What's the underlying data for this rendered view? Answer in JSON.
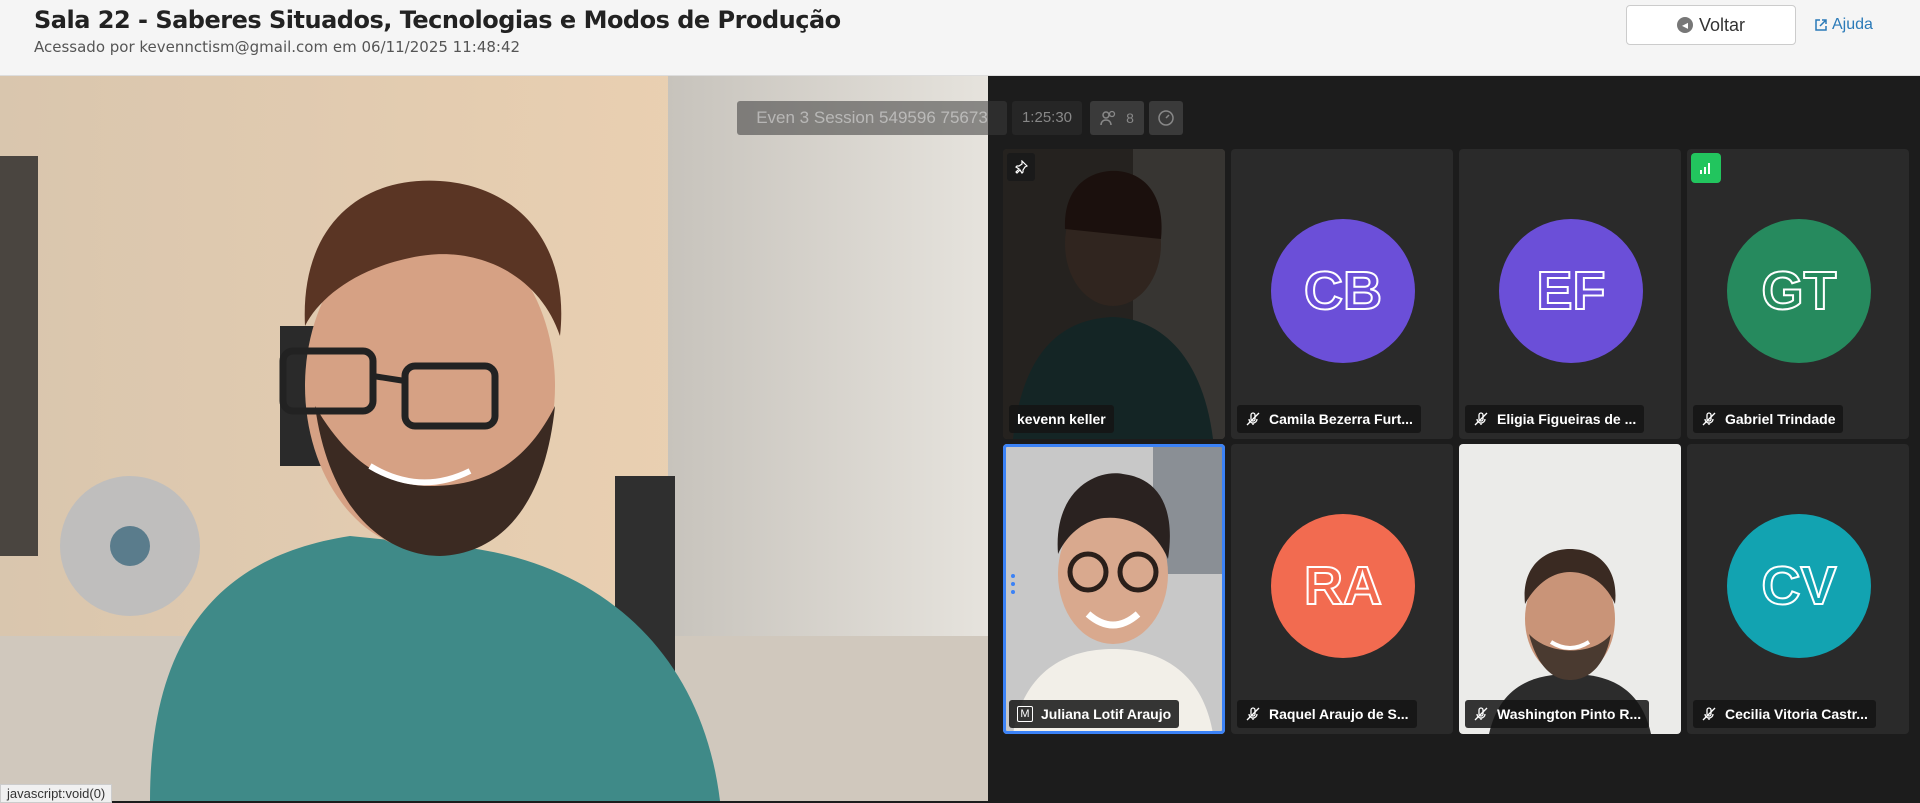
{
  "header": {
    "title": "Sala 22 - Saberes Situados, Tecnologias e Modos de Produção",
    "subtitle": "Acessado por kevennctism@gmail.com em 06/11/2025 11:48:42",
    "back_label": "Voltar",
    "help_label": "Ajuda"
  },
  "status_bar": {
    "text": "javascript:void(0)"
  },
  "toolbar": {
    "session_label": "Even 3 Session 549596 75673",
    "timer": "1:25:30",
    "participant_count": "8"
  },
  "participants": [
    {
      "name": "kevenn keller",
      "type": "video",
      "muted": false,
      "pinned": true
    },
    {
      "name": "Camila Bezerra Furt...",
      "initials": "CB",
      "color": "#6b4fd8",
      "muted": true
    },
    {
      "name": "Eligia Figueiras de ...",
      "initials": "EF",
      "color": "#6b4fd8",
      "muted": true
    },
    {
      "name": "Gabriel Trindade",
      "initials": "GT",
      "color": "#268a5e",
      "muted": true,
      "speaking": true
    },
    {
      "name": "Juliana Lotif Araujo",
      "type": "video",
      "muted": false,
      "moderator": true,
      "active": true
    },
    {
      "name": "Raquel Araujo de S...",
      "initials": "RA",
      "color": "#f26b50",
      "muted": true
    },
    {
      "name": "Washington Pinto R...",
      "type": "video",
      "muted": true
    },
    {
      "name": "Cecilia Vitoria Castr...",
      "initials": "CV",
      "color": "#12a3b1",
      "muted": true
    }
  ],
  "colors": {
    "accent": "#3b82f6",
    "link": "#2a7ab8",
    "speaking": "#22c55e"
  }
}
